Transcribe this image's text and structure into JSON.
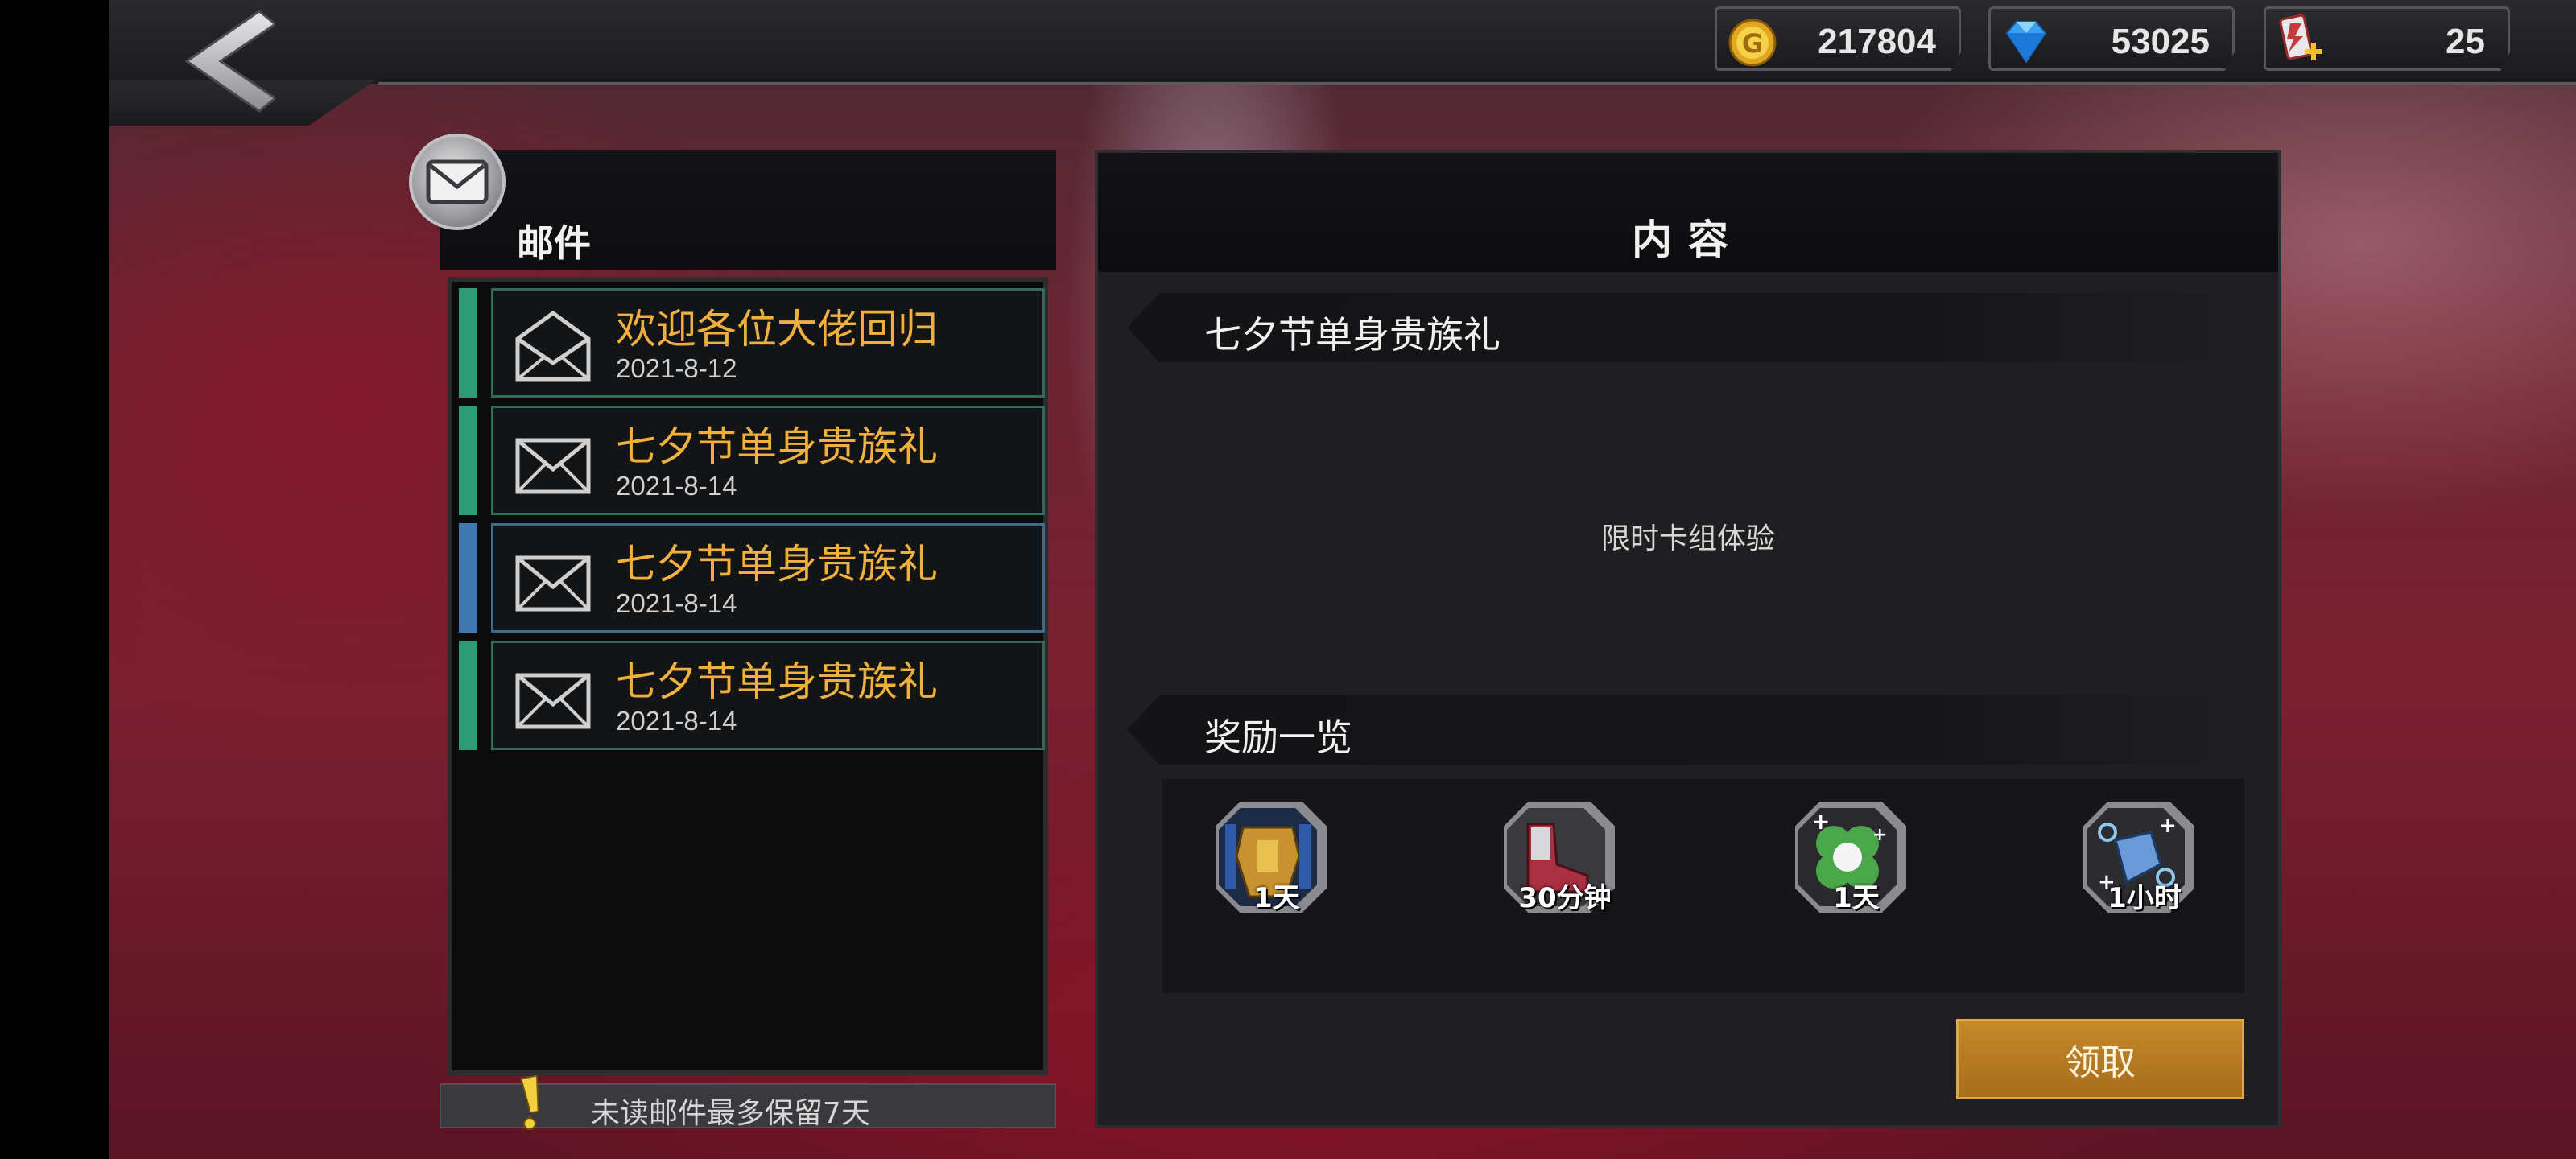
{
  "header": {
    "back_icon": "chevron-left-icon",
    "currencies": [
      {
        "name": "gold",
        "icon": "gold-coin-icon",
        "value": "217804"
      },
      {
        "name": "gem",
        "icon": "diamond-icon",
        "value": "53025"
      },
      {
        "name": "energy",
        "icon": "energy-ticket-icon",
        "value": "25"
      }
    ]
  },
  "mail_panel": {
    "title": "邮件",
    "items": [
      {
        "subject": "欢迎各位大佬回归",
        "date": "2021-8-12",
        "accent": "#2e9b76",
        "opened": true
      },
      {
        "subject": "七夕节单身贵族礼",
        "date": "2021-8-14",
        "accent": "#2e9b76",
        "opened": false
      },
      {
        "subject": "七夕节单身贵族礼",
        "date": "2021-8-14",
        "accent": "#3f78b0",
        "opened": false,
        "selected": true
      },
      {
        "subject": "七夕节单身贵族礼",
        "date": "2021-8-14",
        "accent": "#2e9b76",
        "opened": false
      }
    ],
    "notice": "未读邮件最多保留7天"
  },
  "content_panel": {
    "title": "内容",
    "mail_subject": "七夕节单身贵族礼",
    "body": "限时卡组体验",
    "rewards_title": "奖励一览",
    "rewards": [
      {
        "icon": "gold-armor-card-icon",
        "duration": "1天"
      },
      {
        "icon": "red-boots-card-icon",
        "duration": "30分钟"
      },
      {
        "icon": "clover-card-icon",
        "duration": "1天"
      },
      {
        "icon": "blue-gadget-card-icon",
        "duration": "1小时"
      }
    ],
    "claim_label": "领取"
  },
  "colors": {
    "accent_gold": "#f0b040",
    "button_gold": "#b57a22",
    "mail_border": "#2f6b58"
  }
}
